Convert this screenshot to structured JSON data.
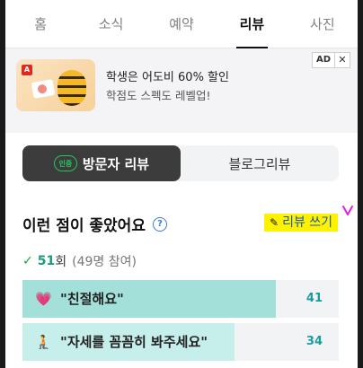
{
  "tabs": [
    "홈",
    "소식",
    "예약",
    "리뷰",
    "사진"
  ],
  "ad": {
    "title": "학생은 어도비 60% 할인",
    "subtitle": "학점도 스펙도 레벨업!",
    "badge": "AD",
    "close": "✕",
    "logo": "A"
  },
  "toggle": {
    "visitor_label": "방문자 리뷰",
    "blog_label": "블로그리뷰",
    "receipt_icon_text": "인증"
  },
  "section": {
    "title": "이런 점이 좋았어요",
    "help": "?",
    "write_label": "리뷰 쓰기",
    "write_icon": "✎"
  },
  "count": {
    "check": "✓",
    "number": "51",
    "unit": "회",
    "participants": "(49명 참여)"
  },
  "keywords": [
    {
      "emoji": "💗",
      "text": "\"친절해요\"",
      "count": "41",
      "fraction": 0.8,
      "color": "#a3e0da"
    },
    {
      "emoji": "🧎",
      "text": "\"자세를 꼼꼼히 봐주세요\"",
      "count": "34",
      "fraction": 0.67,
      "color": "#c6eeeb"
    }
  ],
  "colors": {
    "accent_green": "#16a34a",
    "highlight": "#fff200",
    "link_blue": "#1a55c2"
  }
}
